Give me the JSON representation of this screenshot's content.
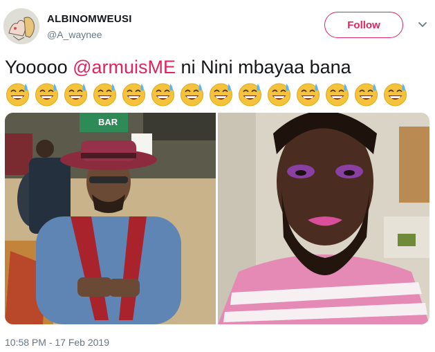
{
  "user": {
    "display_name": "ALBINOMWEUSI",
    "handle": "@A_waynee"
  },
  "follow_button": {
    "label": "Follow"
  },
  "tweet": {
    "text_before": "Yooooo ",
    "mention": "@armuisME",
    "text_after": "  ni Nini mbayaa bana",
    "emoji_count": 14,
    "emoji_name": "grinning-face-with-sweat-icon"
  },
  "photos": [
    {
      "name": "man-in-hat-photo",
      "bar_sign": "BAR"
    },
    {
      "name": "bearded-person-makeup-photo"
    }
  ],
  "meta": {
    "timestamp": "10:58 PM - 17 Feb 2019"
  },
  "colors": {
    "accent": "#e0245e",
    "secondary_text": "#657786"
  }
}
